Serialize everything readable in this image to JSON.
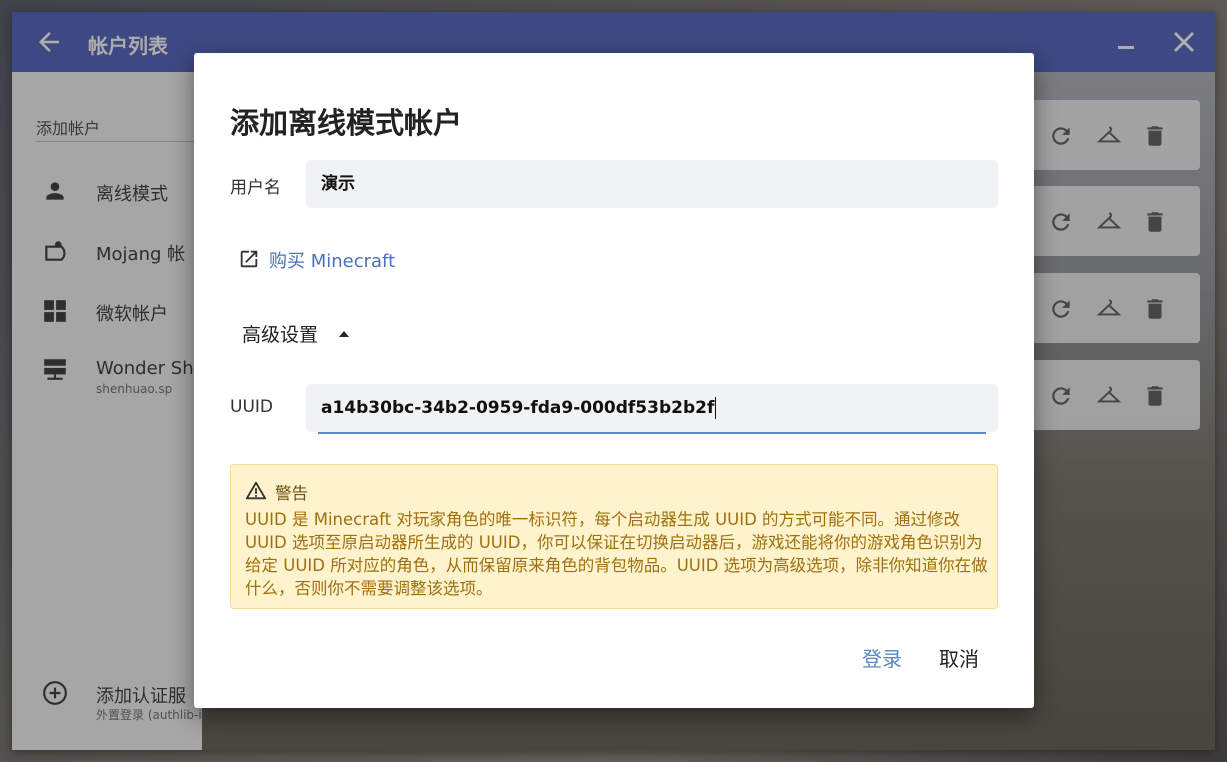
{
  "window": {
    "title": "帐户列表"
  },
  "sidebar": {
    "add_header": "添加帐户",
    "items": [
      {
        "label": "离线模式",
        "icon": "person-icon"
      },
      {
        "label": "Mojang 帐",
        "icon": "mojang-icon"
      },
      {
        "label": "微软帐户",
        "icon": "windows-icon"
      },
      {
        "label": "Wonder Sh",
        "sublabel": "shenhuao.sp",
        "icon": "server-icon"
      }
    ],
    "add_auth_server": {
      "label": "添加认证服",
      "sublabel": "外置登录 (authlib-injector)",
      "icon": "add-circle-icon"
    }
  },
  "dialog": {
    "title": "添加离线模式帐户",
    "username_label": "用户名",
    "username_value": "演示",
    "buy_link": "购买 Minecraft",
    "advanced_label": "高级设置",
    "uuid_label": "UUID",
    "uuid_value": "a14b30bc-34b2-0959-fda9-000df53b2b2f",
    "warning_title": "警告",
    "warning_body": "UUID 是 Minecraft 对玩家角色的唯一标识符，每个启动器生成 UUID 的方式可能不同。通过修改 UUID 选项至原启动器所生成的 UUID，你可以保证在切换启动器后，游戏还能将你的游戏角色识别为给定 UUID 所对应的角色，从而保留原来角色的背包物品。UUID 选项为高级选项，除非你知道你在做什么，否则你不需要调整该选项。",
    "login_button": "登录",
    "cancel_button": "取消"
  },
  "colors": {
    "titlebar": "#5c6bc0",
    "link": "#4b71b8",
    "warning_bg": "#fef3cd",
    "warning_text": "#a0700e",
    "input_underline": "#5e86d6"
  }
}
